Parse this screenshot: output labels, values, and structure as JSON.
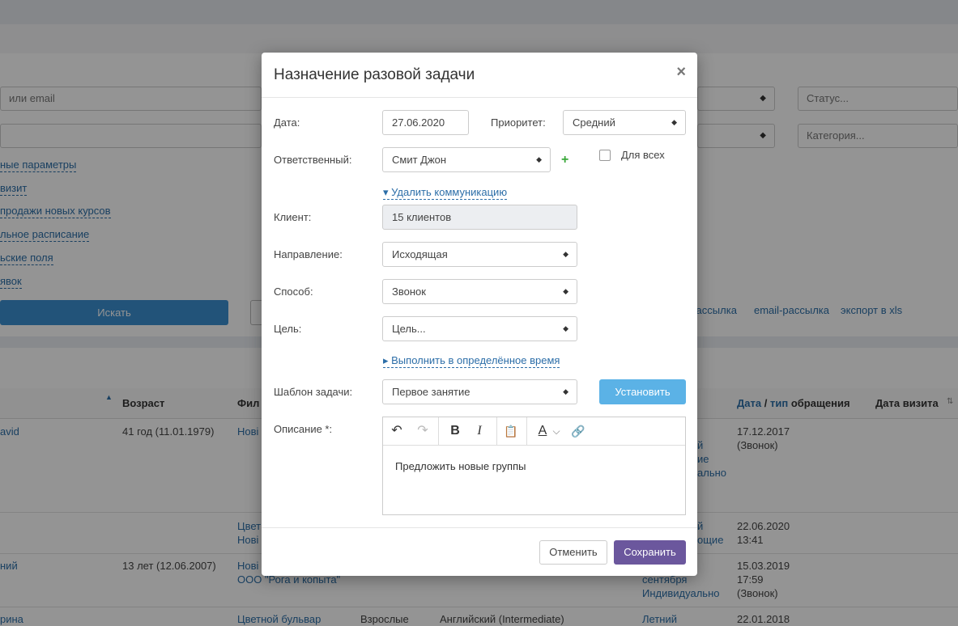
{
  "background": {
    "filters": {
      "search_placeholder": "или email",
      "status_placeholder": "Статус...",
      "category_placeholder": "Категория..."
    },
    "links": [
      "ные параметры",
      "визит",
      "продажи новых курсов",
      "льное расписание",
      "ьские поля",
      "явок"
    ],
    "search_button": "Искать",
    "actions": [
      "-рассылка",
      "email-рассылка",
      "экспорт в xls"
    ],
    "table": {
      "headers": {
        "age": "Возраст",
        "branch": "Фил",
        "date_type_date": "Дата",
        "date_type_slash": "/",
        "date_type_type": "тип",
        "date_type_rest": "обращения",
        "visit_date": "Дата визита"
      },
      "rows": [
        {
          "name": "avid",
          "age": "41 год (11.01.1979)",
          "branch": "Нові",
          "extra": "й\nие\nально",
          "date": "17.12.2017\n(Звонок)"
        },
        {
          "name": "",
          "age": "",
          "branch": "Цвет\nНові",
          "extra": "й\nощие",
          "date": "22.06.2020\n13:41"
        },
        {
          "name": "ний",
          "age": "13 лет (12.06.2007)",
          "branch": "Нові\nООО \"Рога и копыта\"",
          "extra": "сентября\nИндивидуально",
          "date": "15.03.2019\n17:59\n(Звонок)"
        },
        {
          "name": "рина",
          "age": "",
          "branch": "Цветной бульвар",
          "group": "Взрослые",
          "course": "Английский (Intermediate)",
          "extra": "Летний",
          "date": "22.01.2018"
        }
      ]
    }
  },
  "modal": {
    "title": "Назначение разовой задачи",
    "close_icon": "×",
    "date_label": "Дата:",
    "date_value": "27.06.2020",
    "priority_label": "Приоритет:",
    "priority_value": "Средний",
    "responsible_label": "Ответственный:",
    "responsible_value": "Смит Джон",
    "plus": "+",
    "for_all_label": "Для всех",
    "remove_comm_link": "▾ Удалить коммуникацию",
    "client_label": "Клиент:",
    "client_value": "15 клиентов",
    "direction_label": "Направление:",
    "direction_value": "Исходящая",
    "method_label": "Способ:",
    "method_value": "Звонок",
    "goal_label": "Цель:",
    "goal_value": "Цель...",
    "timed_link": "▸ Выполнить в определённое время",
    "template_label": "Шаблон задачи:",
    "template_value": "Первое занятие",
    "install_button": "Установить",
    "description_label": "Описание *:",
    "description_text": "Предложить новые группы",
    "toolbar": {
      "undo": "↶",
      "redo": "↷",
      "bold": "B",
      "italic": "I",
      "paste": "📋",
      "font_color": "A",
      "dropdown": "⌵",
      "link": "🔗"
    },
    "cancel_button": "Отменить",
    "save_button": "Сохранить"
  },
  "colors": {
    "accent_blue": "#5bb2e6",
    "save_purple": "#6b579d",
    "link_blue": "#2c6ea8"
  }
}
